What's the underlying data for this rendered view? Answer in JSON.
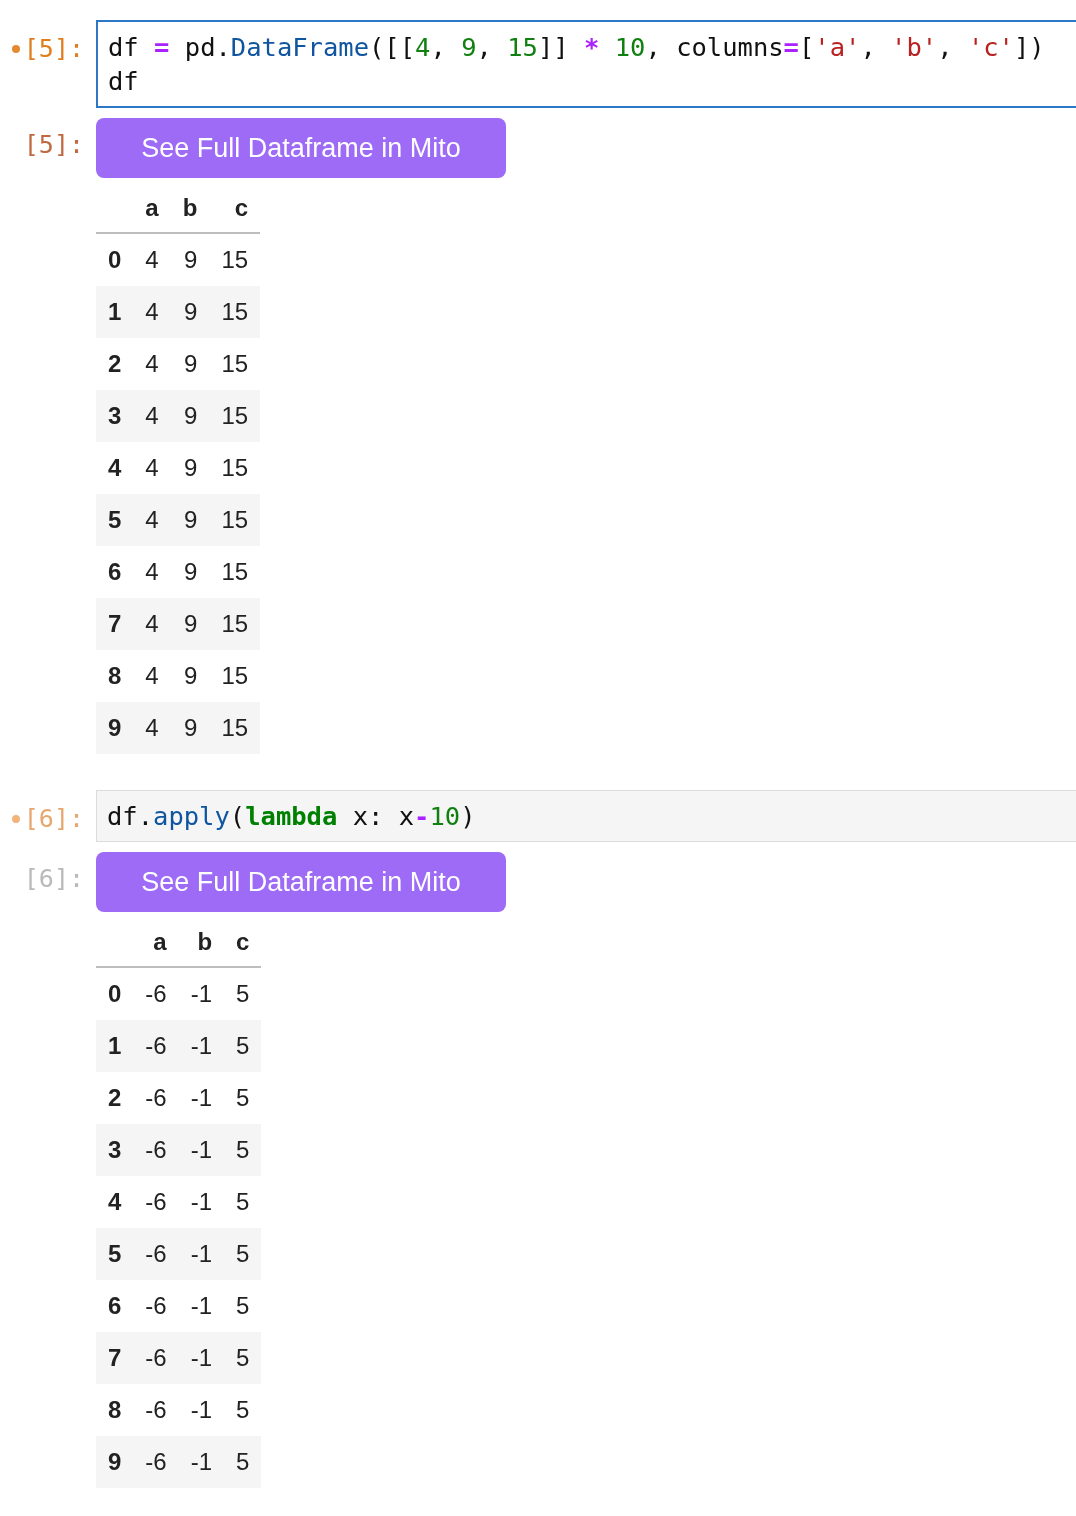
{
  "cells": [
    {
      "selected": true,
      "modified": true,
      "input_prompt": "[5]:",
      "output_prompt": "[5]:",
      "code_lines": [
        [
          {
            "kind": "plain",
            "text": "df "
          },
          {
            "kind": "op",
            "text": "="
          },
          {
            "kind": "plain",
            "text": " pd."
          },
          {
            "kind": "func",
            "text": "DataFrame"
          },
          {
            "kind": "plain",
            "text": "([["
          },
          {
            "kind": "num",
            "text": "4"
          },
          {
            "kind": "plain",
            "text": ", "
          },
          {
            "kind": "num",
            "text": "9"
          },
          {
            "kind": "plain",
            "text": ", "
          },
          {
            "kind": "num",
            "text": "15"
          },
          {
            "kind": "plain",
            "text": "]] "
          },
          {
            "kind": "op",
            "text": "*"
          },
          {
            "kind": "num",
            "text": " 10"
          },
          {
            "kind": "plain",
            "text": ", columns"
          },
          {
            "kind": "op",
            "text": "="
          },
          {
            "kind": "plain",
            "text": "["
          },
          {
            "kind": "str",
            "text": "'a'"
          },
          {
            "kind": "plain",
            "text": ", "
          },
          {
            "kind": "str",
            "text": "'b'"
          },
          {
            "kind": "plain",
            "text": ", "
          },
          {
            "kind": "str",
            "text": "'c'"
          },
          {
            "kind": "plain",
            "text": "])"
          }
        ],
        [
          {
            "kind": "plain",
            "text": "df"
          }
        ]
      ],
      "button": "See Full Dataframe in Mito",
      "table": {
        "columns": [
          "",
          "a",
          "b",
          "c"
        ],
        "rows": [
          [
            "0",
            "4",
            "9",
            "15"
          ],
          [
            "1",
            "4",
            "9",
            "15"
          ],
          [
            "2",
            "4",
            "9",
            "15"
          ],
          [
            "3",
            "4",
            "9",
            "15"
          ],
          [
            "4",
            "4",
            "9",
            "15"
          ],
          [
            "5",
            "4",
            "9",
            "15"
          ],
          [
            "6",
            "4",
            "9",
            "15"
          ],
          [
            "7",
            "4",
            "9",
            "15"
          ],
          [
            "8",
            "4",
            "9",
            "15"
          ],
          [
            "9",
            "4",
            "9",
            "15"
          ]
        ]
      }
    },
    {
      "selected": false,
      "modified": true,
      "input_prompt": "[6]:",
      "output_prompt": "[6]:",
      "code_lines": [
        [
          {
            "kind": "plain",
            "text": "df."
          },
          {
            "kind": "func",
            "text": "apply"
          },
          {
            "kind": "plain",
            "text": "("
          },
          {
            "kind": "keyword",
            "text": "lambda"
          },
          {
            "kind": "plain",
            "text": " x: x"
          },
          {
            "kind": "op",
            "text": "-"
          },
          {
            "kind": "num",
            "text": "10"
          },
          {
            "kind": "plain",
            "text": ")"
          }
        ]
      ],
      "button": "See Full Dataframe in Mito",
      "table": {
        "columns": [
          "",
          "a",
          "b",
          "c"
        ],
        "rows": [
          [
            "0",
            "-6",
            "-1",
            "5"
          ],
          [
            "1",
            "-6",
            "-1",
            "5"
          ],
          [
            "2",
            "-6",
            "-1",
            "5"
          ],
          [
            "3",
            "-6",
            "-1",
            "5"
          ],
          [
            "4",
            "-6",
            "-1",
            "5"
          ],
          [
            "5",
            "-6",
            "-1",
            "5"
          ],
          [
            "6",
            "-6",
            "-1",
            "5"
          ],
          [
            "7",
            "-6",
            "-1",
            "5"
          ],
          [
            "8",
            "-6",
            "-1",
            "5"
          ],
          [
            "9",
            "-6",
            "-1",
            "5"
          ]
        ]
      }
    }
  ]
}
